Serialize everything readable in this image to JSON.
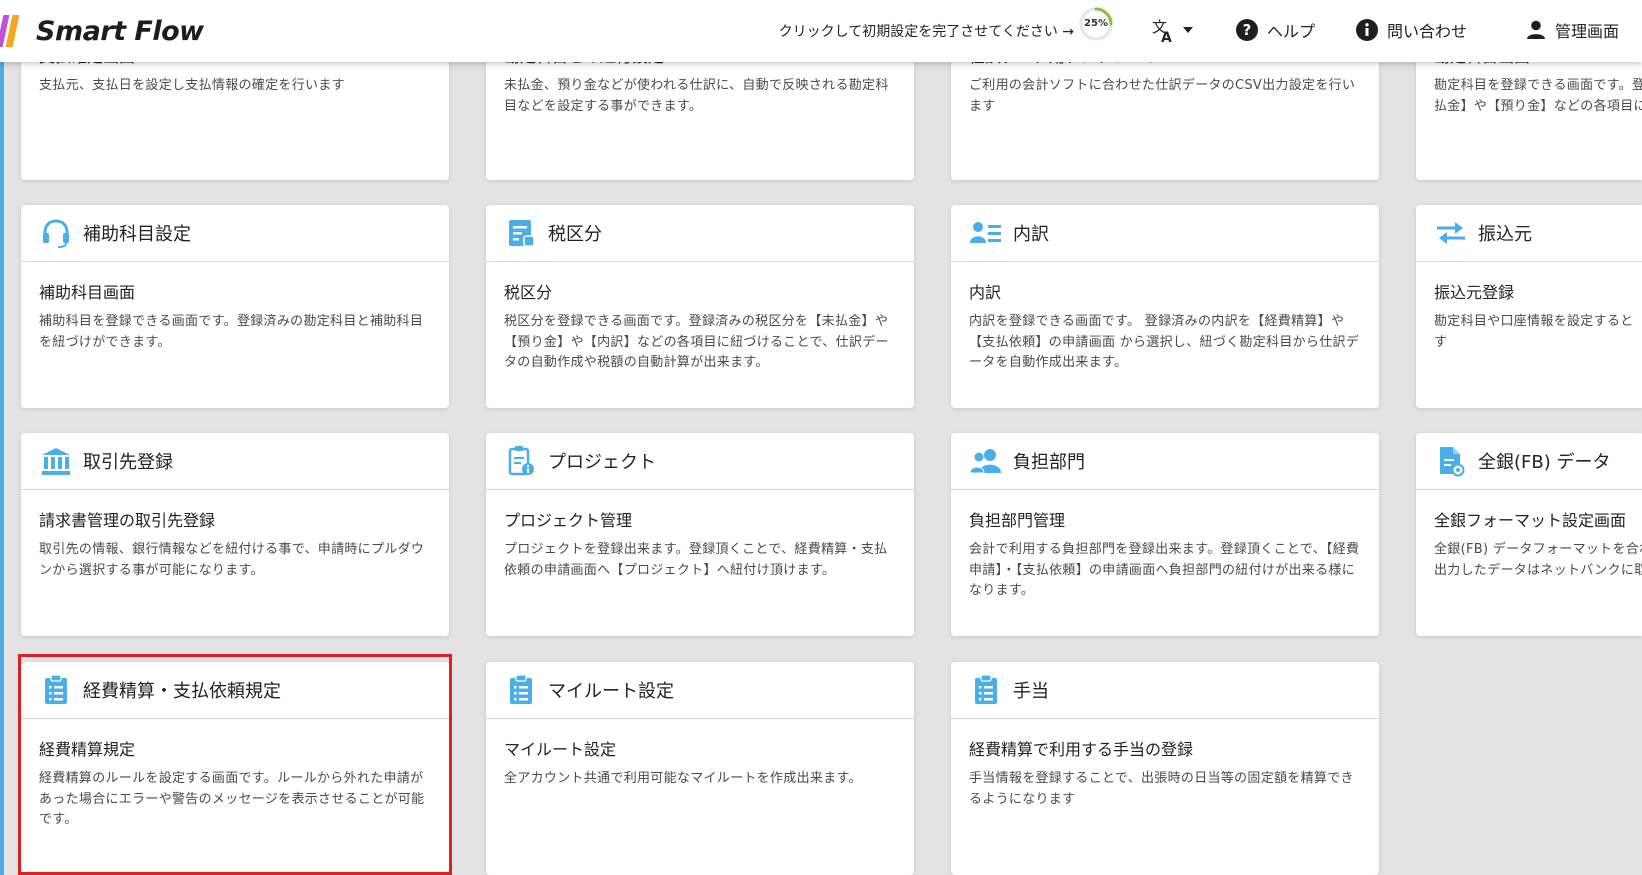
{
  "app": {
    "title": "Smart Flow"
  },
  "header": {
    "setup_text": "クリックして初期設定を完了させてください →",
    "progress_label": "25%",
    "progress_value": 0.25,
    "help_label": "ヘルプ",
    "contact_label": "問い合わせ",
    "admin_label": "管理画面",
    "icons": {
      "translate": "translate-icon",
      "help": "help-circle-icon",
      "info": "info-circle-icon",
      "user": "user-icon"
    }
  },
  "colors": {
    "accent": "#4aaee8",
    "highlight": "#e02020",
    "logo_purple": "#c44fd8",
    "logo_orange": "#f5a623"
  },
  "cards": [
    {
      "title": "",
      "subtitle": "支払確定画面",
      "description": "支払元、支払日を設定し支払情報の確定を行います"
    },
    {
      "title": "",
      "subtitle": "勘定科目との紐付設定",
      "description": "未払金、預り金などが使われる仕訳に、自動で反映される勘定科目などを設定する事ができます。"
    },
    {
      "title": "",
      "subtitle": "仕訳データ用テンプレート",
      "description": "ご利用の会計ソフトに合わせた仕訳データのCSV出力設定を行います"
    },
    {
      "title": "",
      "subtitle": "勘定科目画面",
      "description": "勘定科目を登録できる画面です。登録済みの【補助科目名】や【未払金】や【預り金】などの各項目に紐づけることで、仕訳データ"
    },
    {
      "title": "補助科目設定",
      "subtitle": "補助科目画面",
      "description": "補助科目を登録できる画面です。登録済みの勘定科目と補助科目を紐づけができます。",
      "icon": "headset-icon"
    },
    {
      "title": "税区分",
      "subtitle": "税区分",
      "description": "税区分を登録できる画面です。登録済みの税区分を【未払金】や【預り金】や【内訳】などの各項目に紐づけることで、仕訳データの自動作成や税額の自動計算が出来ます。",
      "icon": "tax-document-icon"
    },
    {
      "title": "内訳",
      "subtitle": "内訳",
      "description": "内訳を登録できる画面です。 登録済みの内訳を【経費精算】や【支払依頼】の申請画面 から選択し、紐づく勘定科目から仕訳データを自動作成出来ます。",
      "icon": "list-person-icon"
    },
    {
      "title": "振込元",
      "subtitle": "振込元登録",
      "description": "勘定科目や口座情報を設定すると【FBデータ】を自動作成出来ます",
      "icon": "transfer-arrows-icon"
    },
    {
      "title": "取引先登録",
      "subtitle": "請求書管理の取引先登録",
      "description": "取引先の情報、銀行情報などを紐付ける事で、申請時にプルダウンから選択する事が可能になります。",
      "icon": "bank-icon"
    },
    {
      "title": "プロジェクト",
      "subtitle": "プロジェクト管理",
      "description": "プロジェクトを登録出来ます。登録頂くことで、経費精算・支払依頼の申請画面へ【プロジェクト】へ紐付け頂けます。",
      "icon": "clipboard-info-icon"
    },
    {
      "title": "負担部門",
      "subtitle": "負担部門管理",
      "description": "会計で利用する負担部門を登録出来ます。登録頂くことで、【経費申請】・【支払依頼】の申請画面へ負担部門の紐付けが出来る様になります。",
      "icon": "people-icon"
    },
    {
      "title": "全銀(FB) データ",
      "subtitle": "全銀フォーマット設定画面",
      "description": "全銀(FB) データフォーマットを合わせて設定が出来ます。また、出力したデータはネットバンクに取り込みが可能です。",
      "icon": "file-settings-icon"
    },
    {
      "title": "経費精算・支払依頼規定",
      "subtitle": "経費精算規定",
      "description": "経費精算のルールを設定する画面です。ルールから外れた申請があった場合にエラーや警告のメッセージを表示させることが可能です。",
      "icon": "clipboard-list-icon"
    },
    {
      "title": "マイルート設定",
      "subtitle": "マイルート設定",
      "description": "全アカウント共通で利用可能なマイルートを作成出来ます。",
      "icon": "clipboard-list-icon"
    },
    {
      "title": "手当",
      "subtitle": "経費精算で利用する手当の登録",
      "description": "手当情報を登録することで、出張時の日当等の固定額を精算できるようになります",
      "icon": "clipboard-list-icon"
    }
  ]
}
